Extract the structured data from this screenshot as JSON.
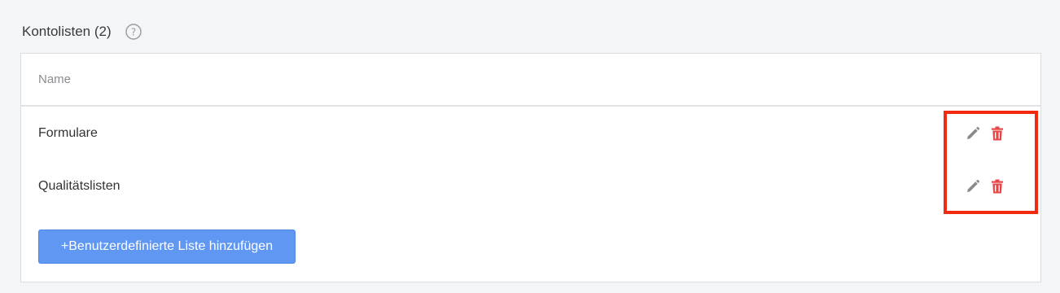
{
  "section": {
    "title": "Kontolisten (2)",
    "help_icon": "question-circle-icon"
  },
  "table": {
    "columns": [
      "Name"
    ],
    "rows": [
      {
        "name": "Formulare",
        "actions": [
          "pencil-icon",
          "trash-icon"
        ]
      },
      {
        "name": "Qualitätslisten",
        "actions": [
          "pencil-icon",
          "trash-icon"
        ]
      }
    ]
  },
  "add_button": {
    "label": "+Benutzerdefinierte Liste hinzufügen"
  },
  "colors": {
    "accent": "#5f97f2",
    "delete": "#e8474a",
    "edit": "#8a8a8a",
    "highlight": "#f12a10"
  }
}
